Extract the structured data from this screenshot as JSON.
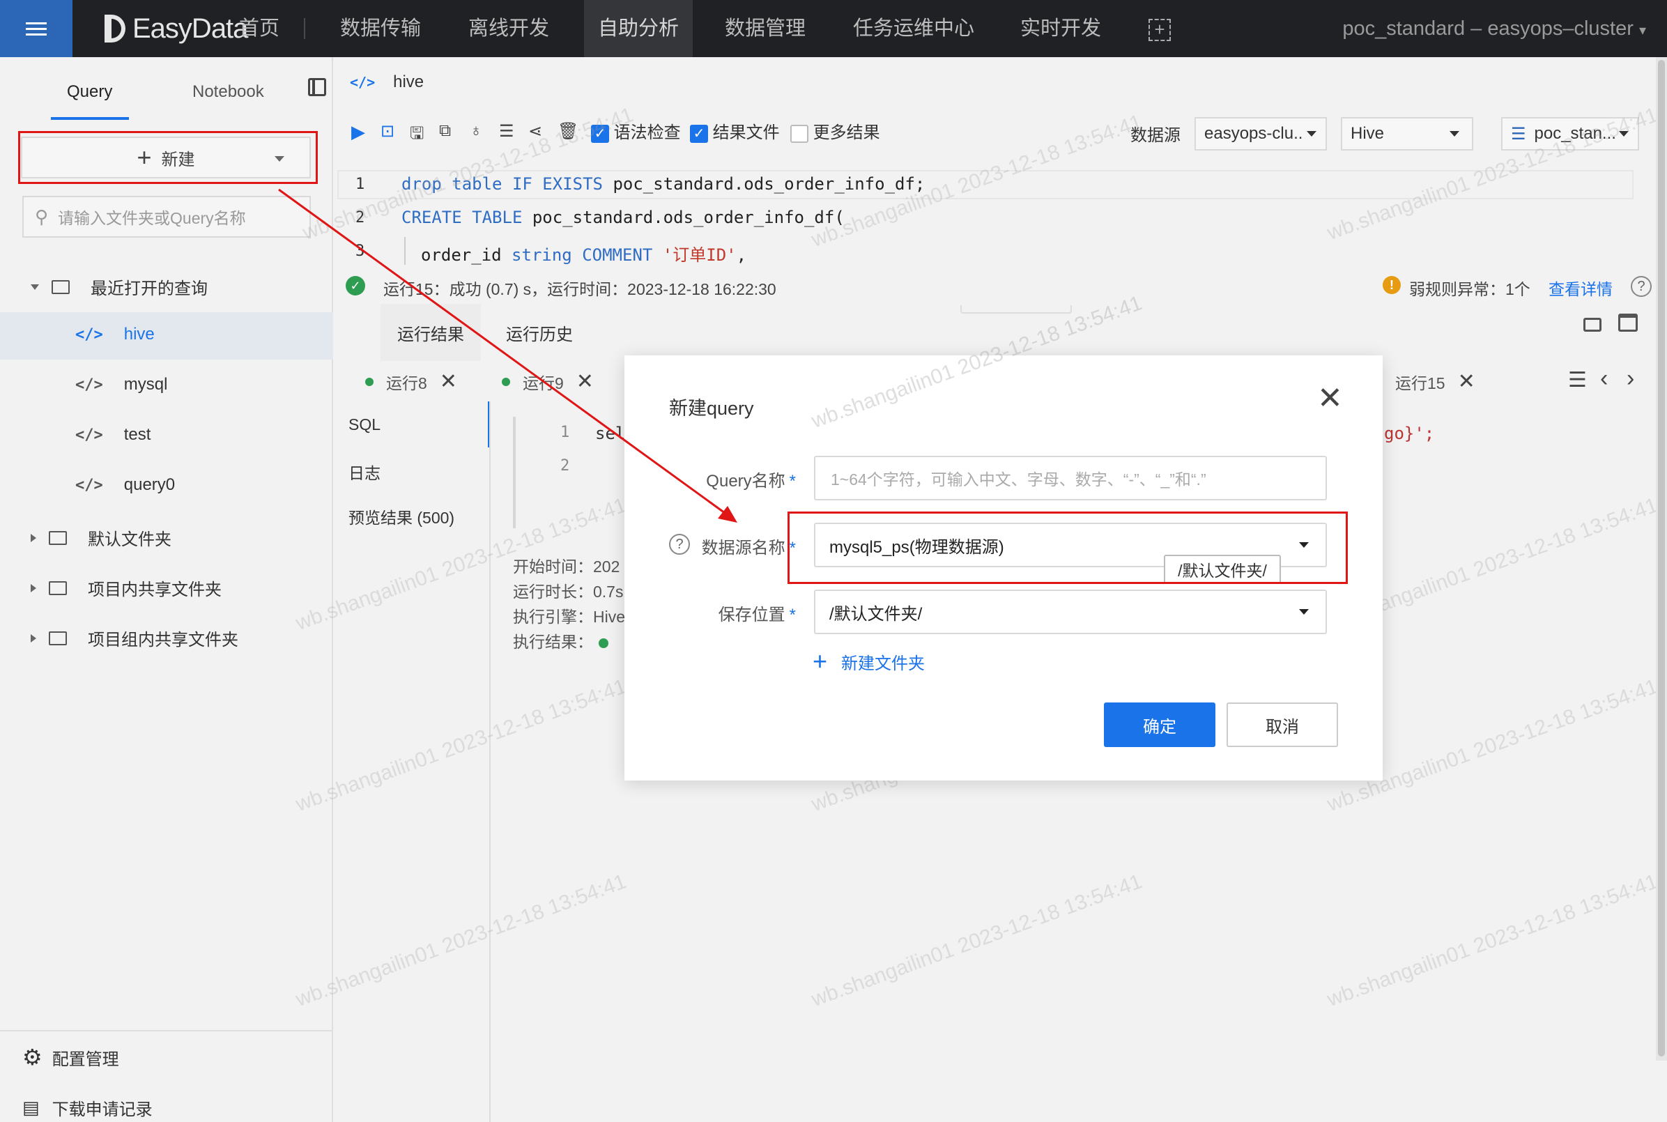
{
  "topbar": {
    "brand": "EasyData",
    "nav": [
      "首页",
      "数据传输",
      "离线开发",
      "自助分析",
      "数据管理",
      "任务运维中心",
      "实时开发"
    ],
    "active_nav": "自助分析",
    "cluster": "poc_standard – easyops–cluster"
  },
  "sidebar": {
    "tabs": [
      "Query",
      "Notebook"
    ],
    "new_button": "新建",
    "search_placeholder": "请输入文件夹或Query名称",
    "recent_folder": "最近打开的查询",
    "recent_items": [
      "hive",
      "mysql",
      "test",
      "query0"
    ],
    "folders": [
      "默认文件夹",
      "项目内共享文件夹",
      "项目组内共享文件夹"
    ],
    "bottom": [
      "配置管理",
      "下载申请记录"
    ]
  },
  "editor": {
    "tab_name": "hive",
    "checkboxes": [
      {
        "label": "语法检查",
        "checked": true
      },
      {
        "label": "结果文件",
        "checked": true
      },
      {
        "label": "更多结果",
        "checked": false
      }
    ],
    "datasource_label": "数据源",
    "cluster_select": "easyops-clu..",
    "engine_select": "Hive",
    "db_select": "poc_stan...",
    "line_numbers": [
      "1",
      "2",
      "3"
    ],
    "line1_kw1": "drop table",
    "line1_kw2": "IF EXISTS",
    "line1_rest": " poc_standard.ods_order_info_df;",
    "line2_kw": "CREATE TABLE",
    "line2_rest": " poc_standard.ods_order_info_df(",
    "line3_name": "order_id ",
    "line3_type": "string",
    "line3_kw": " COMMENT ",
    "line3_str": "'订单ID'",
    "line3_end": ",",
    "status": "运行15：成功 (0.7) s，运行时间：2023-12-18 16:22:30",
    "weak_rule": "弱规则异常：1个",
    "view_detail": "查看详情"
  },
  "results": {
    "tabs": [
      "运行结果",
      "运行历史"
    ],
    "runs": [
      "运行8",
      "运行9",
      "运行15"
    ],
    "left_list": [
      "SQL",
      "日志",
      "预览结果 (500)"
    ],
    "code_lines": [
      "1",
      "2"
    ],
    "code_frag": "sel",
    "code_tail": "go}';",
    "info": [
      "开始时间：202",
      "运行时长：0.7s",
      "执行引擎：Hive",
      "执行结果："
    ]
  },
  "watermark": "wb.shangailin01 2023-12-18 13:54:41",
  "modal": {
    "title": "新建query",
    "query_label": "Query名称",
    "query_placeholder": "1~64个字符，可输入中文、字母、数字、“-”、“_”和“.”",
    "datasource_label": "数据源名称",
    "datasource_value": "mysql5_ps(物理数据源)",
    "tooltip": "/默认文件夹/",
    "save_label": "保存位置",
    "save_value": "/默认文件夹/",
    "new_folder": "新建文件夹",
    "ok": "确定",
    "cancel": "取消"
  },
  "colors": {
    "accent": "#1a73e8",
    "annotation": "#e01515",
    "topbar": "#202124"
  }
}
